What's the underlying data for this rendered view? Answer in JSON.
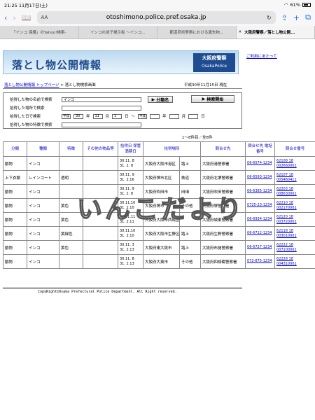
{
  "status": {
    "time": "21:25",
    "date": "11月17日(土)",
    "battery": "61%"
  },
  "browser": {
    "url": "otoshimono.police.pref.osaka.jp",
    "aa": "AA"
  },
  "tabs": [
    {
      "label": "「インコ 保護」のYahoo!検索-"
    },
    {
      "label": "インコの迷子掲示板 〜インコ..."
    },
    {
      "label": "都道府県警察における遺失物..."
    },
    {
      "label": "大阪府警察／落とし物公開..."
    }
  ],
  "header": {
    "title": "落とし物公開情報",
    "logo_jp": "大阪府警察",
    "logo_en": "OsakaPolice",
    "help": "ご利用にあたって"
  },
  "breadcrumb": {
    "link": "落とし物公開情報 トップページ",
    "sep": " > ",
    "current": "落とし物検索画面"
  },
  "date_label": "平成30年11月15日 現在",
  "form": {
    "name_label": "拾得した物の名前で検索",
    "name_value": "インコ",
    "category_btn": "分類名",
    "search_btn": "検索開始",
    "place_label": "拾得した場所で検索",
    "date_label": "拾得した日で検索",
    "era": "平成",
    "year": "30",
    "month": "11",
    "day": "1",
    "u_year": "年",
    "u_month": "月",
    "u_day": "日",
    "tilde": "〜",
    "era2": "平成",
    "feature_label": "拾得した物の特徴で検索"
  },
  "count": "1〜8件目／全8件",
  "columns": [
    "分類",
    "種類",
    "特徴",
    "その他の物品等",
    "拾得日 保管満期日",
    "拾得場所",
    "",
    "問合せ先",
    "問合せ先 電話番号",
    "問合せ番号"
  ],
  "rows": [
    {
      "cat": "動物",
      "type": "インコ",
      "feat": "",
      "other": "",
      "d1": "30.11. 8",
      "d2": "31. 2. 8",
      "place": "大阪府大阪市港区",
      "pl2": "路上",
      "contact": "大阪府港警察署",
      "tel": "06-6574-1234",
      "no": "62108 18 002660001"
    },
    {
      "cat": "上下衣類",
      "type": "レインコート",
      "feat": "透明",
      "other": "",
      "d1": "30.11. 9",
      "d2": "31. 2.16",
      "place": "大阪府堺市北区",
      "pl2": "鉄道",
      "contact": "大阪府北堺警察署",
      "tel": "06-6593-1234",
      "no": "62107 18 005460411"
    },
    {
      "cat": "動物",
      "type": "インコ",
      "feat": "",
      "other": "",
      "d1": "30.11. 9",
      "d2": "31. 2. 8",
      "place": "大阪府吹田市",
      "pl2": "田畑",
      "contact": "大阪府吹田警察署",
      "tel": "06-6385-1234",
      "no": "62203 18 008630001"
    },
    {
      "cat": "動物",
      "type": "インコ",
      "feat": "黄色",
      "other": "",
      "d1": "30.11.10",
      "d2": "31. 2.10",
      "place": "大阪府堺市",
      "pl2": "その他",
      "contact": "大阪府堺警察署",
      "tel": "0725-23-1234",
      "no": "62210 18 002170001"
    },
    {
      "cat": "動物",
      "type": "インコ",
      "feat": "黄色",
      "other": "",
      "d1": "30.11.11",
      "d2": "31. 2.11",
      "place": "大阪府大阪市西成区",
      "pl2": "",
      "contact": "大阪府城東警察署",
      "tel": "06-6934-1234",
      "no": "62120 18 003720001"
    },
    {
      "cat": "動物",
      "type": "インコ",
      "feat": "黄緑色",
      "other": "",
      "d1": "30.11.10",
      "d2": "31. 2.10",
      "place": "大阪府大阪市生野区",
      "pl2": "路上",
      "contact": "大阪府生野警察署",
      "tel": "06-6712-1234",
      "no": "62118 18 003010001"
    },
    {
      "cat": "動物",
      "type": "インコ",
      "feat": "黄色",
      "other": "",
      "d1": "30.11. 3",
      "d2": "31. 2.13",
      "place": "大阪府東大阪市",
      "pl2": "路上",
      "contact": "大阪府布施警察署",
      "tel": "06-6727-1234",
      "no": "62222 18 007100001"
    },
    {
      "cat": "動物",
      "type": "インコ",
      "feat": "",
      "other": "",
      "d1": "30.11. 8",
      "d2": "31. 2.13",
      "place": "大阪府大東市",
      "pl2": "その他",
      "contact": "大阪府四條畷警察署",
      "tel": "072-875-1234",
      "no": "62228 18 004310001"
    }
  ],
  "copyright": "CopyRight©Osaka Prefectural Police Department. All Right reserved.",
  "watermark": "いんこだより"
}
